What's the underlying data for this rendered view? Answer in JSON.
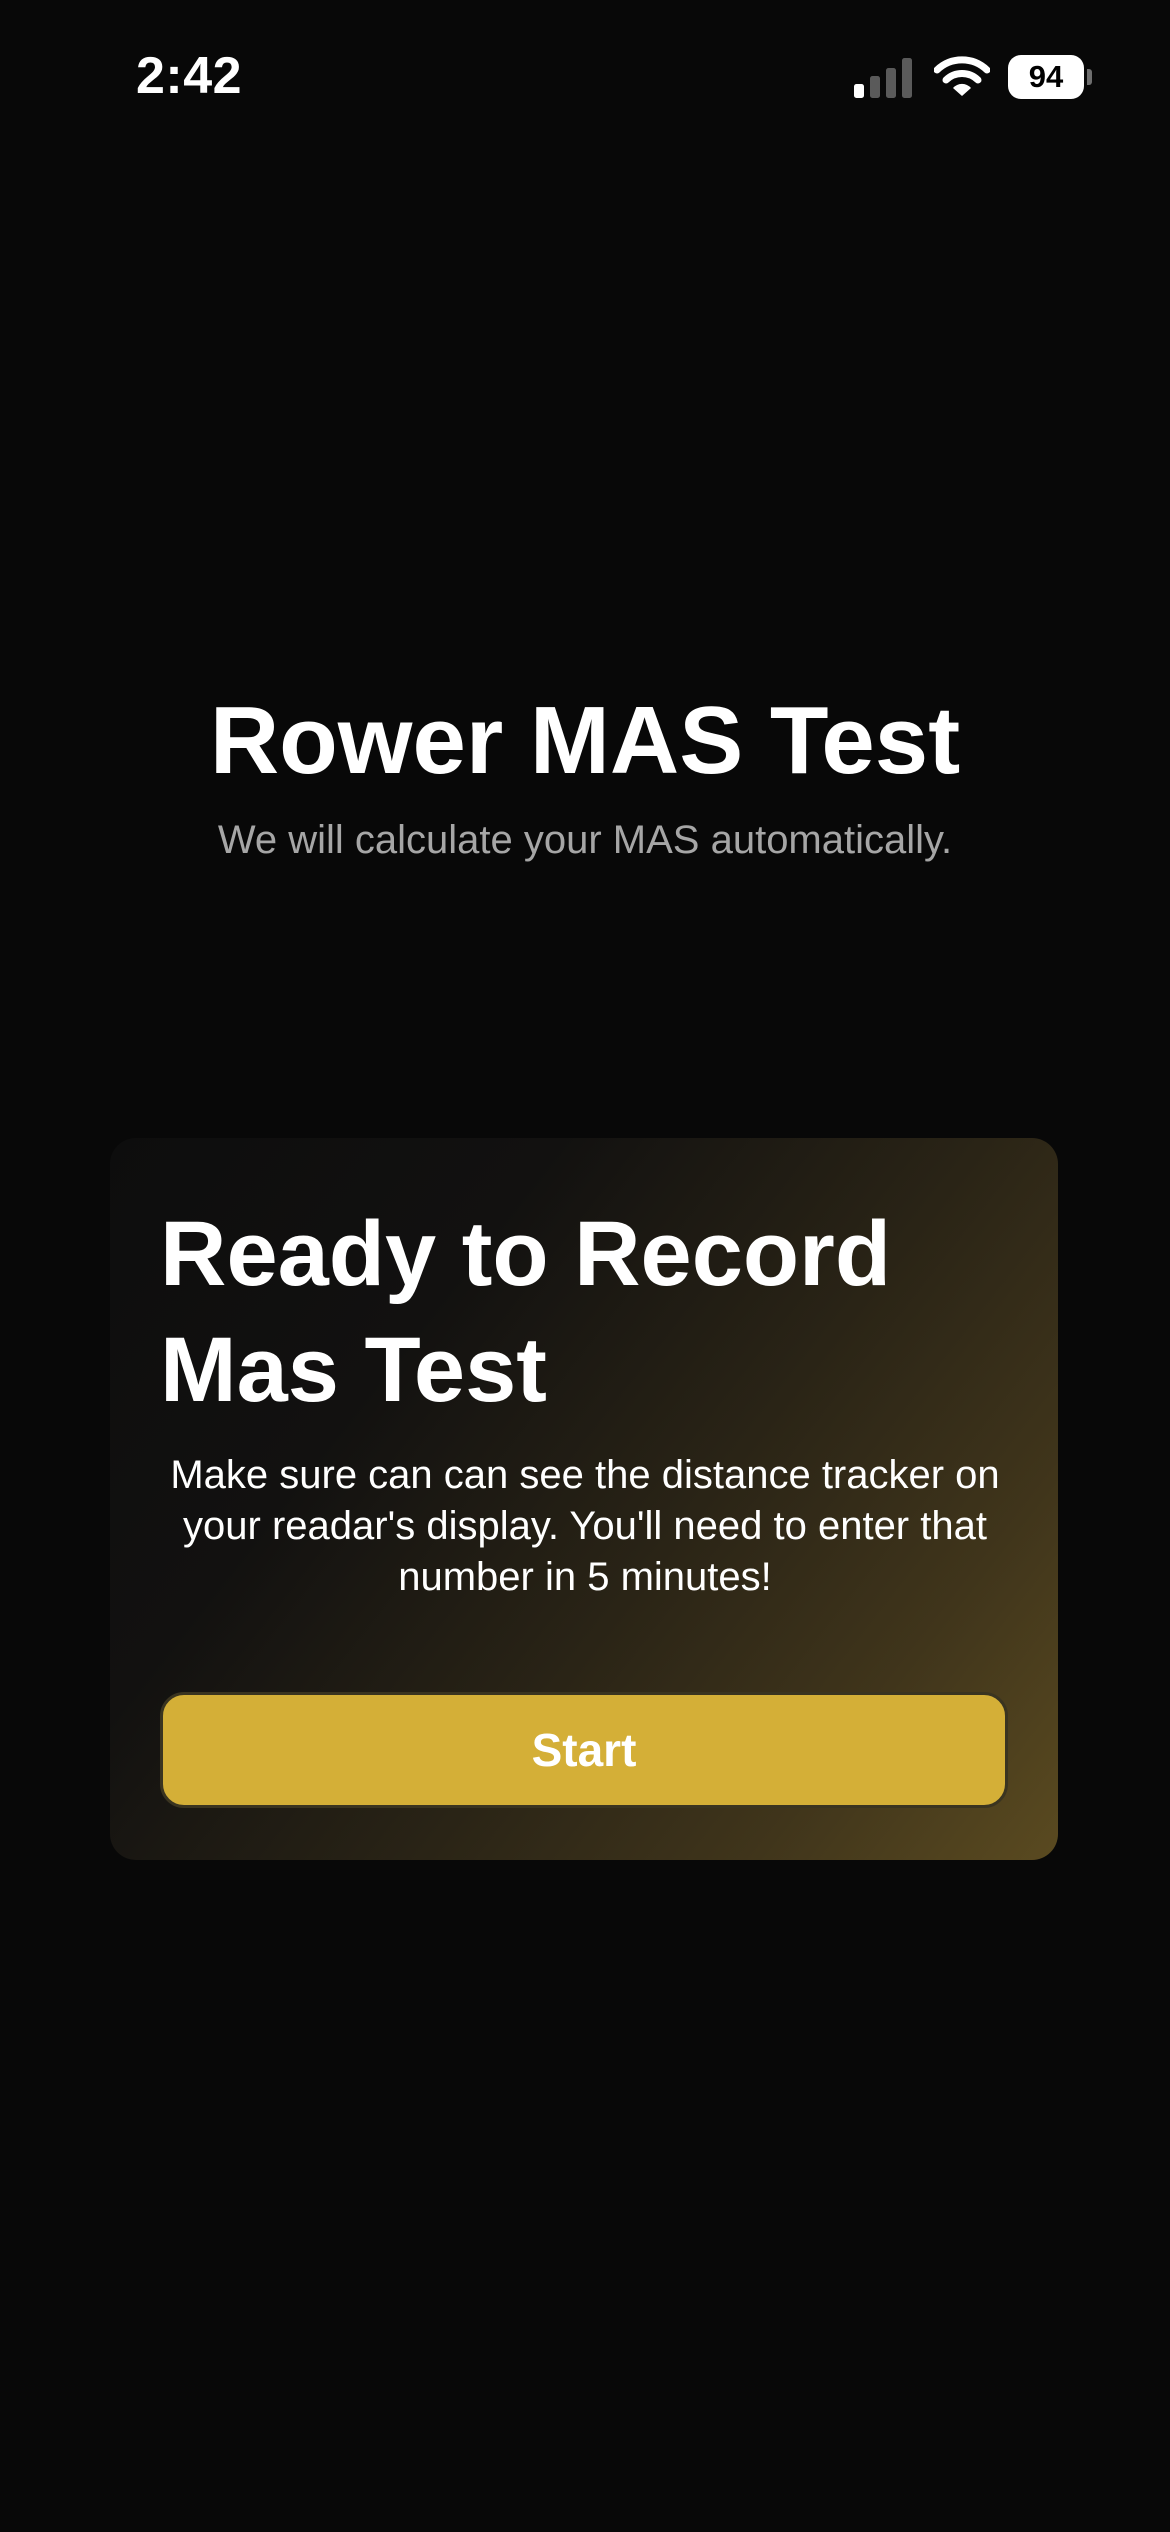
{
  "status_bar": {
    "time": "2:42",
    "battery_level": "94",
    "signal_icon": "cellular-signal-icon",
    "wifi_icon": "wifi-icon"
  },
  "header": {
    "title": "Rower MAS Test",
    "subtitle": "We will calculate your MAS automatically."
  },
  "card": {
    "title_line1": "Ready to Record",
    "title_line2": "Mas Test",
    "body": "Make sure can can see the distance tracker on your readar's display. You'll need to enter that number in 5 minutes!",
    "button_label": "Start"
  },
  "colors": {
    "background": "#080808",
    "accent": "#d4af37",
    "subtitle": "#a6a6a6"
  }
}
